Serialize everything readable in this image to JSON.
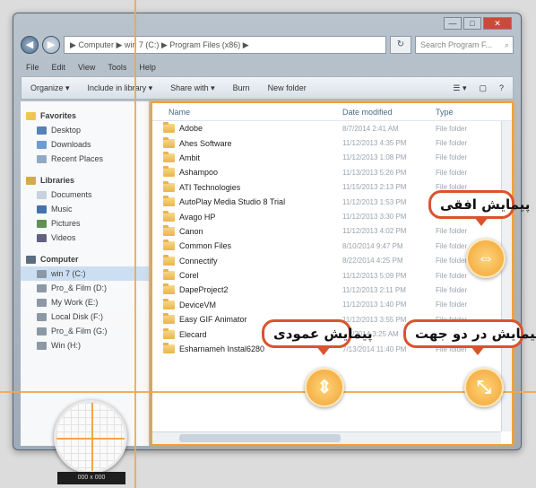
{
  "window": {
    "controls": [
      "—",
      "□",
      "✕"
    ],
    "address": "▶ Computer ▶ win 7 (C:) ▶ Program Files (x86) ▶",
    "search_placeholder": "Search Program F...",
    "search_icon": "search-icon"
  },
  "menu": [
    "File",
    "Edit",
    "View",
    "Tools",
    "Help"
  ],
  "toolbar": {
    "organize": "Organize ▾",
    "include": "Include in library ▾",
    "share": "Share with ▾",
    "burn": "Burn",
    "new_folder": "New folder",
    "view": "☰ ▾",
    "pane": "▢",
    "help": "?"
  },
  "nav_pane": {
    "favorites": "Favorites",
    "favorites_items": [
      "Desktop",
      "Downloads",
      "Recent Places"
    ],
    "libraries": "Libraries",
    "libraries_items": [
      "Documents",
      "Music",
      "Pictures",
      "Videos"
    ],
    "computer": "Computer",
    "computer_items": [
      "win 7 (C:)",
      "Pro_& Film (D:)",
      "My Work (E:)",
      "Local Disk (F:)",
      "Pro_& Film (G:)",
      "Win (H:)"
    ]
  },
  "file_list": {
    "columns": {
      "name": "Name",
      "date": "Date modified",
      "type": "Type"
    },
    "rows": [
      {
        "name": "Adobe",
        "date": "8/7/2014 2:41 AM",
        "type": "File folder"
      },
      {
        "name": "Ahes Software",
        "date": "11/12/2013 4:35 PM",
        "type": "File folder"
      },
      {
        "name": "Ambit",
        "date": "11/12/2013 1:08 PM",
        "type": "File folder"
      },
      {
        "name": "Ashampoo",
        "date": "11/13/2013 5:26 PM",
        "type": "File folder"
      },
      {
        "name": "ATI Technologies",
        "date": "11/15/2013 2:13 PM",
        "type": "File folder"
      },
      {
        "name": "AutoPlay Media Studio 8 Trial",
        "date": "11/12/2013 1:53 PM",
        "type": "File folder"
      },
      {
        "name": "Avago HP",
        "date": "11/12/2013 3:30 PM",
        "type": "File folder"
      },
      {
        "name": "Canon",
        "date": "11/12/2013 4:02 PM",
        "type": "File folder"
      },
      {
        "name": "Common Files",
        "date": "8/10/2014 9:47 PM",
        "type": "File folder"
      },
      {
        "name": "Connectify",
        "date": "8/22/2014 4:25 PM",
        "type": "File folder"
      },
      {
        "name": "Corel",
        "date": "11/12/2013 5:09 PM",
        "type": "File folder"
      },
      {
        "name": "DapeProject2",
        "date": "11/12/2013 2:11 PM",
        "type": "File folder"
      },
      {
        "name": "DeviceVM",
        "date": "11/12/2013 1:40 PM",
        "type": "File folder"
      },
      {
        "name": "Easy GIF Animator",
        "date": "11/12/2013 3:55 PM",
        "type": "File folder"
      },
      {
        "name": "Elecard",
        "date": "5/2/2014 3:25 AM",
        "type": "File folder"
      },
      {
        "name": "Esharnameh Instal6280",
        "date": "7/13/2014 11:40 PM",
        "type": "File folder"
      }
    ]
  },
  "callouts": {
    "horizontal": "پیمایش افقی",
    "vertical": "پیمایش عمودی",
    "both": "پیمایش در دو جهت"
  },
  "magnifier_label": "000 x 000",
  "colors": {
    "guide": "#f2a64a",
    "callout_border": "#d9542e"
  }
}
